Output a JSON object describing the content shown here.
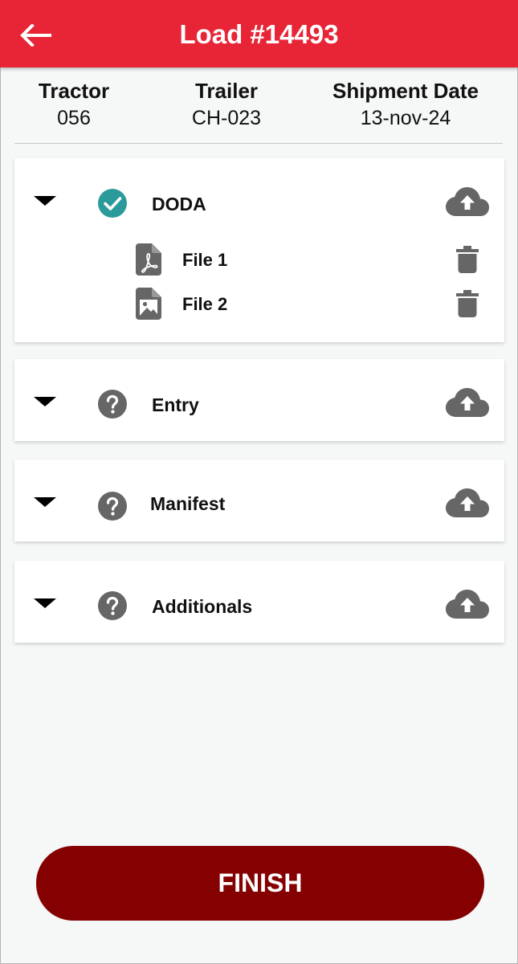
{
  "header": {
    "title": "Load #14493",
    "back_icon": "arrow-left-icon"
  },
  "info": {
    "tractor": {
      "label": "Tractor",
      "value": "056"
    },
    "trailer": {
      "label": "Trailer",
      "value": "CH-023"
    },
    "shipment_date": {
      "label": "Shipment Date",
      "value": "13-nov-24"
    }
  },
  "documents": [
    {
      "label": "DODA",
      "status": "complete",
      "expanded": true,
      "files": [
        {
          "label": "File 1",
          "type": "pdf"
        },
        {
          "label": "File 2",
          "type": "image"
        }
      ]
    },
    {
      "label": "Entry",
      "status": "pending",
      "expanded": false,
      "files": []
    },
    {
      "label": "Manifest",
      "status": "pending",
      "expanded": false,
      "files": []
    },
    {
      "label": "Additionals",
      "status": "pending",
      "expanded": false,
      "files": []
    }
  ],
  "finish_label": "FINISH",
  "colors": {
    "header": "#e72536",
    "finish_button": "#850000",
    "check": "#2b9a9b",
    "icon_gray": "#666666",
    "background": "#f6f7f7"
  }
}
